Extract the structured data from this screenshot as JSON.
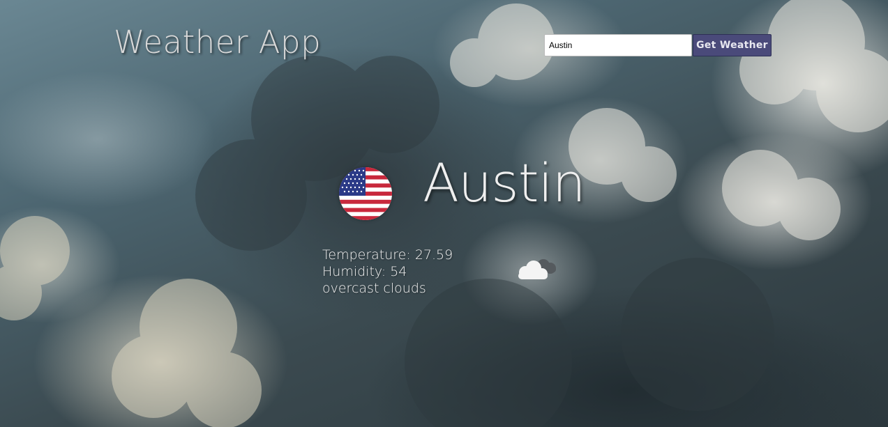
{
  "header": {
    "app_title": "Weather App",
    "search_value": "Austin",
    "button_label": "Get Weather"
  },
  "weather": {
    "city": "Austin",
    "country_flag": "us-flag-icon",
    "temperature_label": "Temperature:",
    "temperature_value": "27.59",
    "humidity_label": "Humidity:",
    "humidity_value": "54",
    "description": "overcast clouds",
    "icon": "overcast-clouds-icon"
  },
  "colors": {
    "button": "#4a4a7a",
    "text": "#efefef"
  }
}
